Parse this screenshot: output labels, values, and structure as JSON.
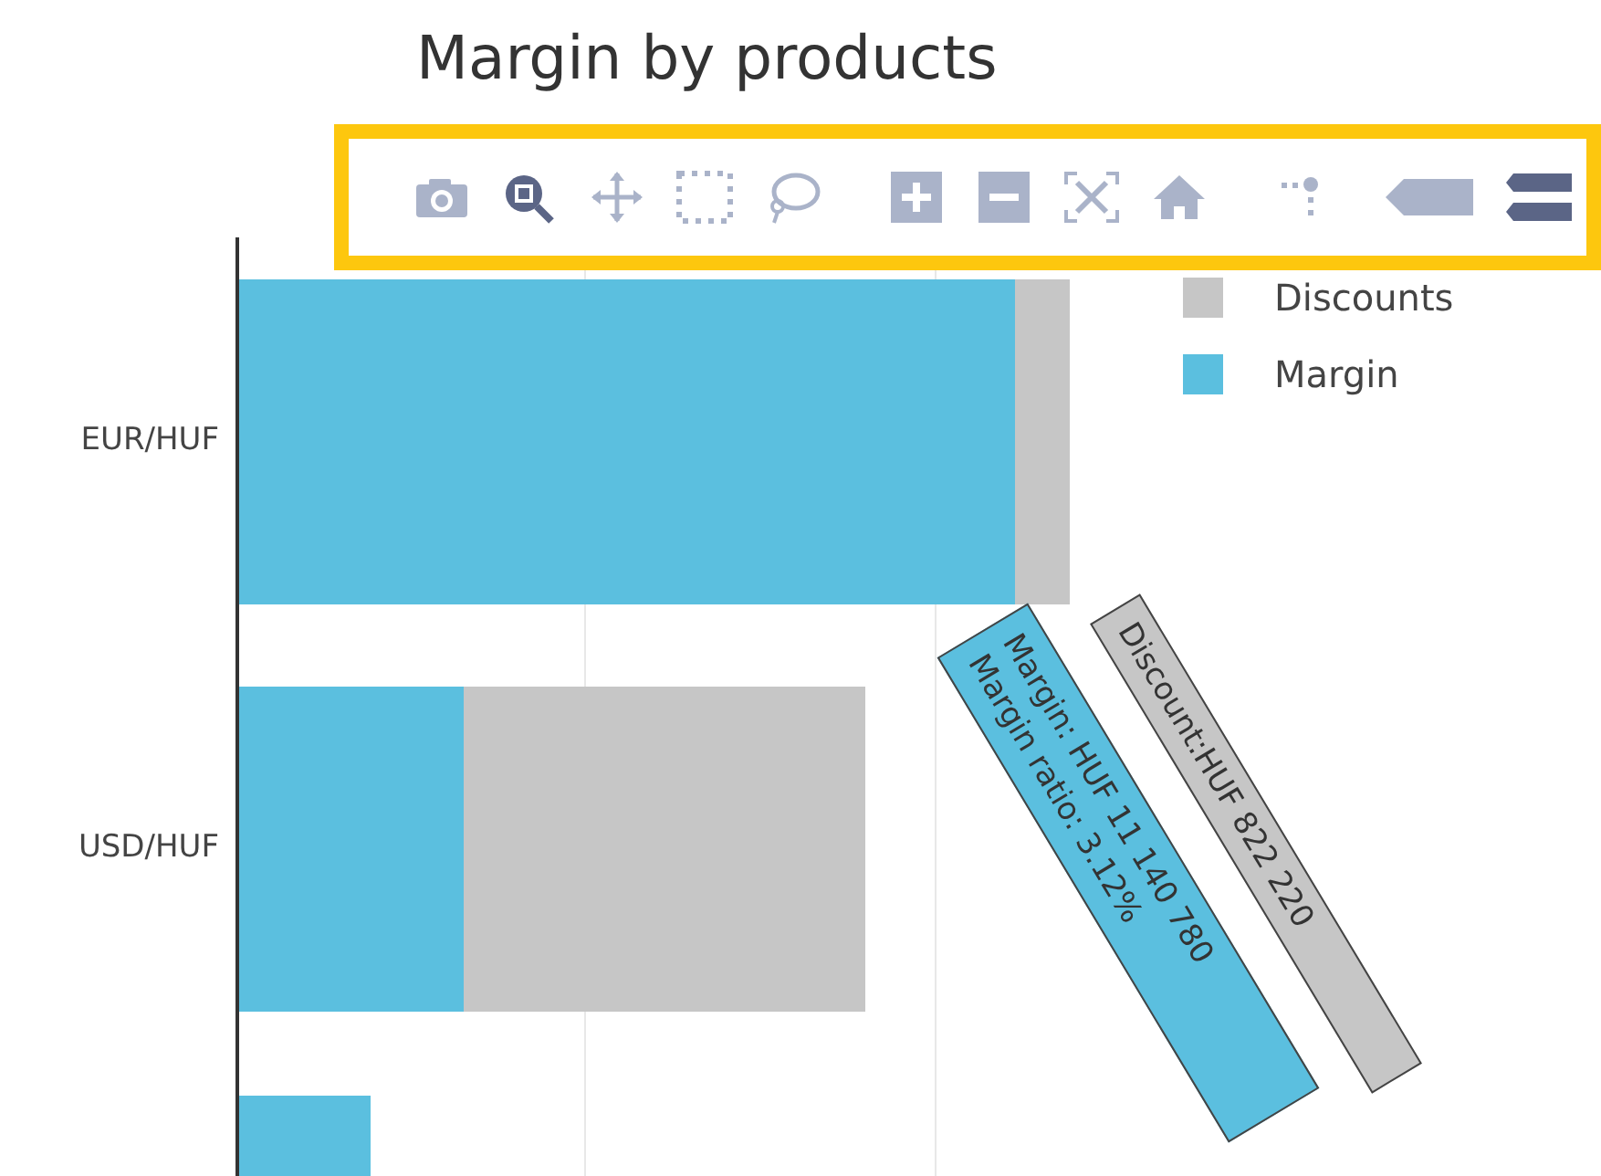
{
  "title": "Margin by products",
  "modebar": {
    "buttons": [
      {
        "kind": "camera",
        "selected": false
      },
      {
        "kind": "zoom",
        "selected": true
      },
      {
        "kind": "pan",
        "selected": false
      },
      {
        "kind": "box-select",
        "selected": false
      },
      {
        "kind": "lasso",
        "selected": false
      },
      {
        "kind": "zoom-in",
        "selected": false
      },
      {
        "kind": "zoom-out",
        "selected": false
      },
      {
        "kind": "autoscale",
        "selected": false
      },
      {
        "kind": "home",
        "selected": false
      },
      {
        "kind": "spikelines",
        "selected": false
      },
      {
        "kind": "hover-closest",
        "selected": false
      },
      {
        "kind": "hover-compare",
        "selected": true
      }
    ]
  },
  "chart": {
    "categories": [
      "EUR/HUF",
      "USD/HUF"
    ],
    "legend": [
      {
        "label": "Discounts",
        "color": "#c6c6c6"
      },
      {
        "label": "Margin",
        "color": "#5bbfdf"
      }
    ],
    "tooltips": [
      {
        "kind": "discount",
        "color": "#c6c6c6",
        "lines": [
          "Discount:HUF 822 220"
        ]
      },
      {
        "kind": "margin",
        "color": "#5bbfdf",
        "lines": [
          "Margin: HUF 11 140 780",
          "Margin ratio: 3.12%"
        ]
      }
    ]
  }
}
